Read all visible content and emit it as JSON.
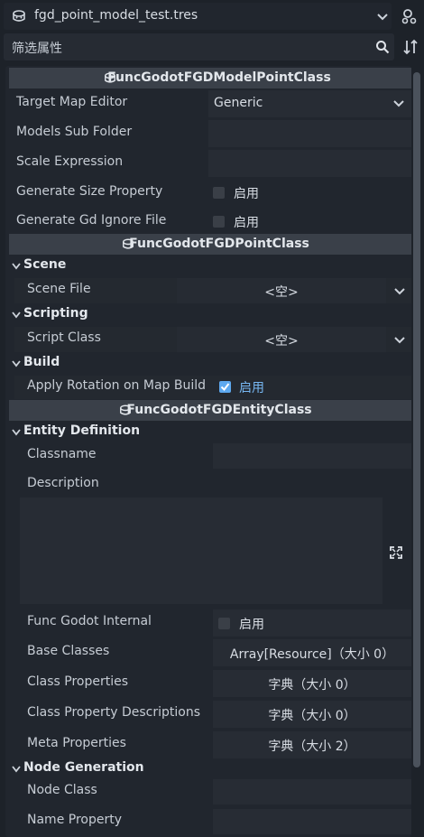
{
  "header": {
    "resource_name": "fgd_point_model_test.tres",
    "filter_placeholder": "筛选属性"
  },
  "categories": {
    "model_point": "FuncGodotFGDModelPointClass",
    "point": "FuncGodotFGDPointClass",
    "entity": "FuncGodotFGDEntityClass"
  },
  "model_point": {
    "target_map_editor": {
      "label": "Target Map Editor",
      "value": "Generic"
    },
    "models_sub_folder": {
      "label": "Models Sub Folder",
      "value": ""
    },
    "scale_expression": {
      "label": "Scale Expression",
      "value": ""
    },
    "generate_size_property": {
      "label": "Generate Size Property",
      "value": "启用",
      "checked": false
    },
    "generate_gd_ignore_file": {
      "label": "Generate Gd Ignore File",
      "value": "启用",
      "checked": false
    }
  },
  "point": {
    "scene_section": "Scene",
    "scene_file": {
      "label": "Scene File",
      "value": "<空>"
    },
    "scripting_section": "Scripting",
    "script_class": {
      "label": "Script Class",
      "value": "<空>"
    },
    "build_section": "Build",
    "apply_rotation": {
      "label": "Apply Rotation on Map Build",
      "value": "启用",
      "checked": true
    }
  },
  "entity": {
    "definition_section": "Entity Definition",
    "classname": {
      "label": "Classname",
      "value": ""
    },
    "description": {
      "label": "Description",
      "value": ""
    },
    "func_godot_internal": {
      "label": "Func Godot Internal",
      "value": "启用",
      "checked": false
    },
    "base_classes": {
      "label": "Base Classes",
      "value": "Array[Resource]（大小 0）"
    },
    "class_properties": {
      "label": "Class Properties",
      "value": "字典（大小 0）"
    },
    "class_property_descriptions": {
      "label": "Class Property Descriptions",
      "value": "字典（大小 0）"
    },
    "meta_properties": {
      "label": "Meta Properties",
      "value": "字典（大小 2）"
    },
    "node_generation_section": "Node Generation",
    "node_class": {
      "label": "Node Class",
      "value": ""
    },
    "name_property": {
      "label": "Name Property",
      "value": ""
    }
  },
  "colors": {
    "background": "#1d2229",
    "panel": "#21262e",
    "category_bar": "#3a4049",
    "field": "#272c34",
    "accent": "#5ea9ef"
  }
}
